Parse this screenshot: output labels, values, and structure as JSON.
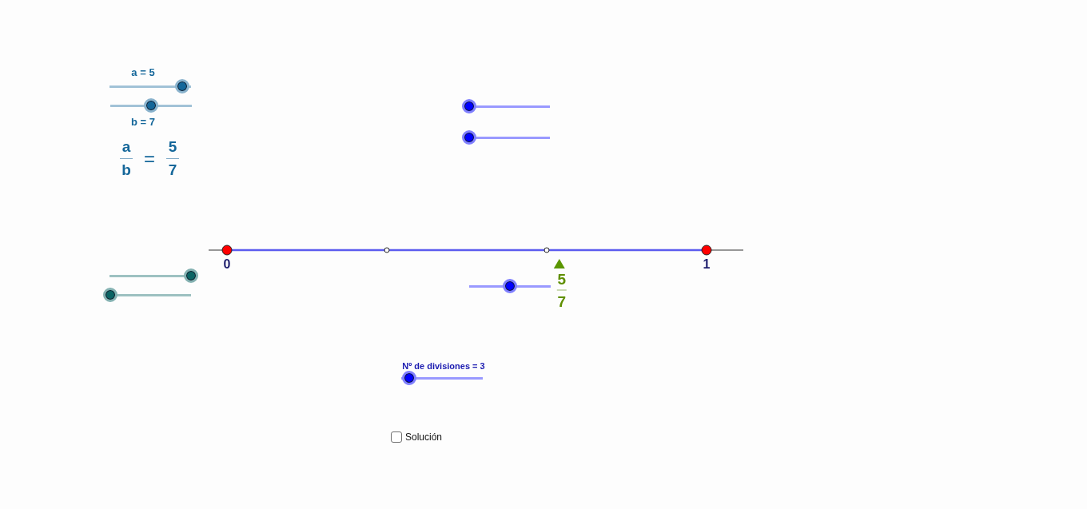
{
  "ratio_sliders": [
    {
      "label": "a = 5",
      "level": 0.89
    },
    {
      "label": "b = 7",
      "level": 0.5
    }
  ],
  "ratio": {
    "left": {
      "numerator": "a",
      "denominator": "b"
    },
    "sign": "=",
    "right": {
      "numerator": "5",
      "denominator": "7"
    }
  },
  "sliders": [
    {
      "level": 0,
      "color": "#0000ff"
    },
    {
      "level": 0,
      "color": "#0000ff"
    },
    {
      "level": 1,
      "color": "#0b6464"
    },
    {
      "level": 0.5,
      "color": "#0000ff"
    },
    {
      "level": 0,
      "color": "#0b6464"
    }
  ],
  "number_line": {
    "points": [
      {
        "kind": "endpoint",
        "label": "0"
      },
      {
        "kind": "division"
      },
      {
        "kind": "division"
      },
      {
        "kind": "endpoint",
        "label": "1"
      }
    ],
    "marker": {
      "level": 0.693,
      "numerator": "5",
      "denominator": "7"
    }
  },
  "divisions_slider": {
    "label": "Nº de divisiones = 3",
    "level": 0.1
  },
  "solution_checkbox": {
    "label": "Solución",
    "checked": false
  }
}
